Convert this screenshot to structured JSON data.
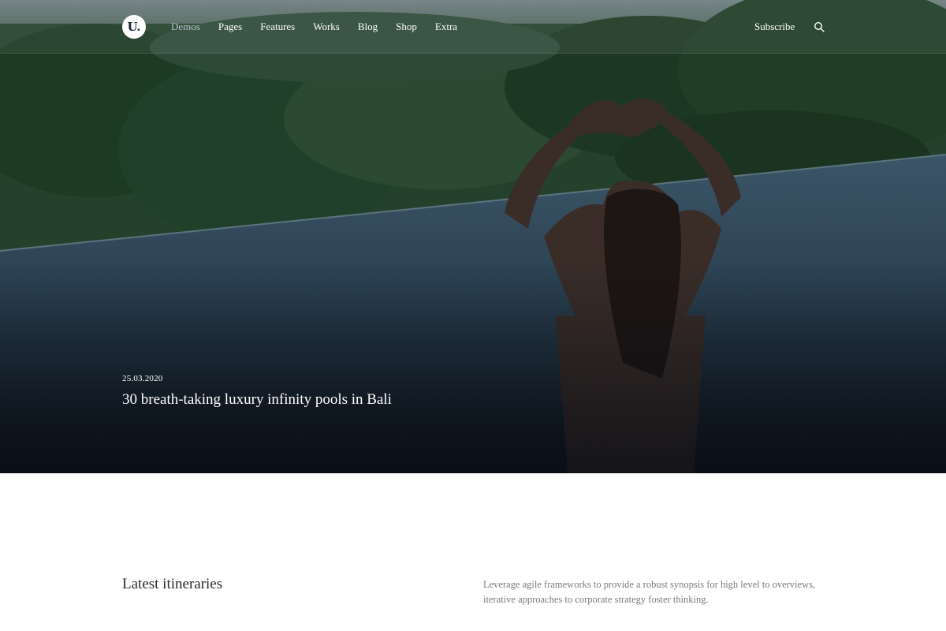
{
  "nav": {
    "logo_text": "U.",
    "items": [
      {
        "label": "Demos",
        "active": true
      },
      {
        "label": "Pages",
        "active": false
      },
      {
        "label": "Features",
        "active": false
      },
      {
        "label": "Works",
        "active": false
      },
      {
        "label": "Blog",
        "active": false
      },
      {
        "label": "Shop",
        "active": false
      },
      {
        "label": "Extra",
        "active": false
      }
    ],
    "subscribe_label": "Subscribe",
    "search_icon": "search-icon"
  },
  "hero": {
    "date": "25.03.2020",
    "title": "30 breath-taking luxury infinity pools in Bali",
    "image": "woman-in-infinity-pool-heart-hands-jungle"
  },
  "section": {
    "title": "Latest itineraries",
    "description": "Leverage agile frameworks to provide a robust synopsis for high level to overviews, iterative approaches to corporate strategy foster thinking."
  },
  "colors": {
    "nav_active": "#b8c3cc",
    "text_light": "#ffffff",
    "body_text": "#7a7a7a"
  }
}
